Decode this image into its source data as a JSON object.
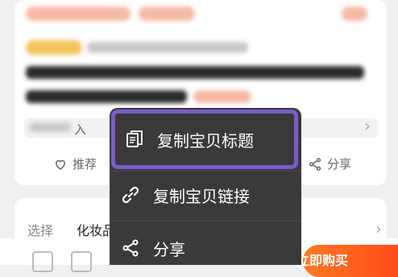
{
  "product": {
    "share_banner_text": "入",
    "actions": {
      "recommend_label": "推荐",
      "share_label": "分享"
    }
  },
  "select": {
    "label": "选择",
    "value": "化妆品"
  },
  "context_menu": {
    "items": [
      {
        "label": "复制宝贝标题",
        "icon": "copy-icon"
      },
      {
        "label": "复制宝贝链接",
        "icon": "link-icon"
      },
      {
        "label": "分享",
        "icon": "share-icon"
      }
    ],
    "highlight_color": "#7b5cc9",
    "background_color": "#3a3a3a"
  },
  "bottom_bar": {
    "buy_label": "立即购买",
    "buy_color": "#ff5a1f"
  }
}
